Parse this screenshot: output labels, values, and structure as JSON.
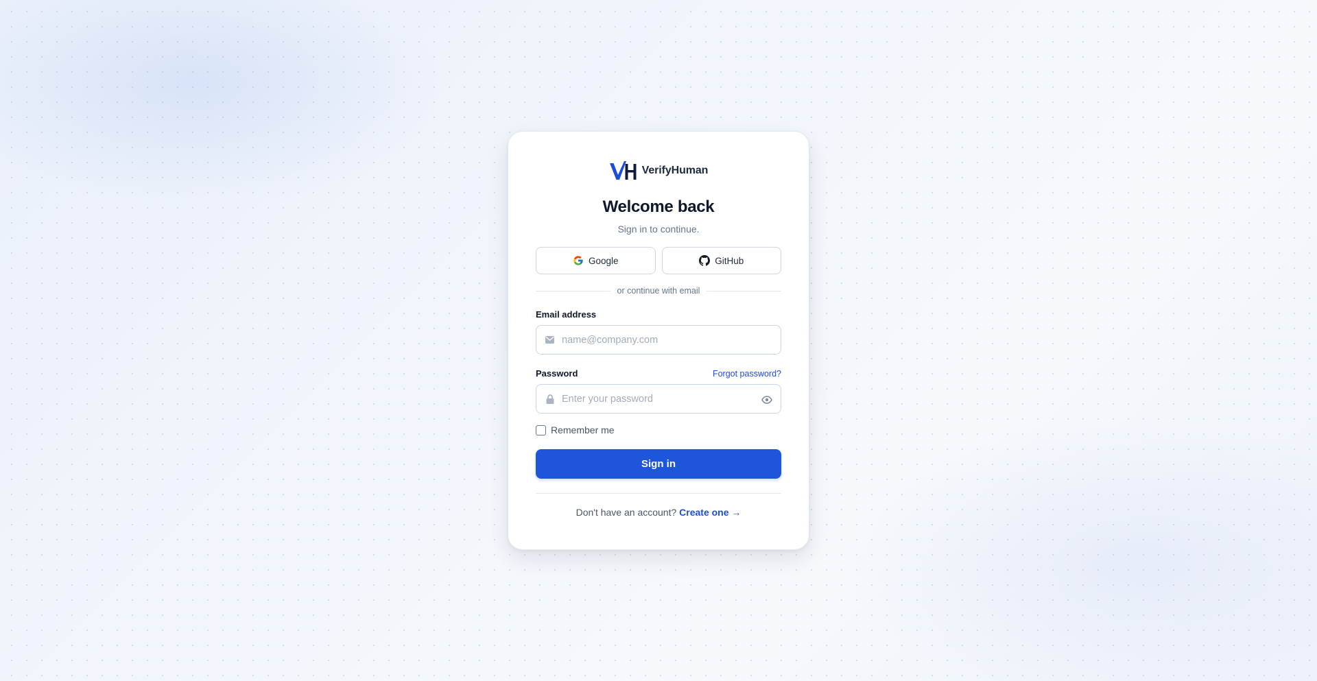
{
  "brand": {
    "name": "VerifyHuman",
    "logo_text": "VH",
    "logo_icon": "vh-logo-icon"
  },
  "header": {
    "title": "Welcome back",
    "subtitle": "Sign in to continue."
  },
  "social": {
    "google_label": "Google",
    "google_icon": "google-icon",
    "github_label": "GitHub",
    "github_icon": "github-icon"
  },
  "divider_text": "or continue with email",
  "email": {
    "label": "Email address",
    "placeholder": "name@company.com",
    "value": "",
    "icon": "envelope-icon"
  },
  "password": {
    "label": "Password",
    "placeholder": "Enter your password",
    "value": "",
    "forgot_label": "Forgot password?",
    "icon": "lock-icon",
    "toggle_icon": "eye-icon"
  },
  "remember": {
    "label": "Remember me",
    "checked": false
  },
  "submit_label": "Sign in",
  "footer": {
    "prompt": "Don't have an account?",
    "link_label": "Create one →"
  },
  "colors": {
    "primary": "#1d56db",
    "link": "#1d4ed8",
    "logo_blue": "#1d4ed8",
    "logo_dark": "#0f1d3d",
    "text_dark": "#0f172a",
    "text_muted": "#64748b"
  }
}
